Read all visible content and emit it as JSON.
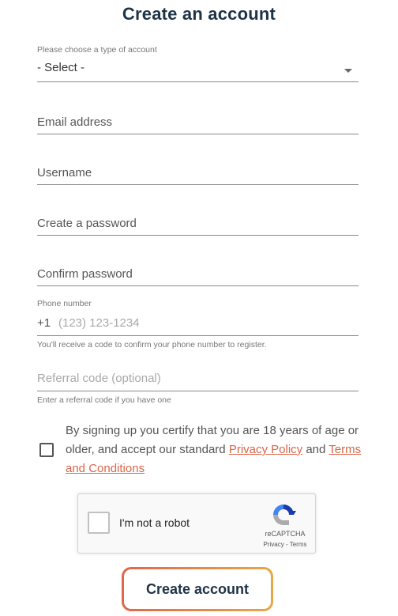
{
  "header": {
    "title": "Create an account"
  },
  "account_type": {
    "label": "Please choose a type of account",
    "selected": "- Select -"
  },
  "fields": {
    "email": {
      "placeholder": "Email address"
    },
    "username": {
      "placeholder": "Username"
    },
    "password": {
      "placeholder": "Create a password"
    },
    "confirm_password": {
      "placeholder": "Confirm password"
    }
  },
  "phone": {
    "label": "Phone number",
    "prefix": "+1",
    "placeholder": "(123) 123-1234",
    "helper": "You'll receive a code to confirm your phone number to register."
  },
  "referral": {
    "placeholder": "Referral code (optional)",
    "helper": "Enter a referral code if you have one"
  },
  "consent": {
    "text_before": "By signing up you certify that you are 18 years of age or older, and accept our standard ",
    "privacy_link": "Privacy Policy",
    "text_middle": " and ",
    "terms_link": "Terms and Conditions",
    "checked": false
  },
  "recaptcha": {
    "label": "I'm not a robot",
    "brand": "reCAPTCHA",
    "links": "Privacy - Terms",
    "checked": false
  },
  "submit": {
    "label": "Create account"
  },
  "colors": {
    "title": "#1f3347",
    "link": "#d9664a",
    "button_gradient_start": "#df6749",
    "button_gradient_end": "#e9a748"
  }
}
